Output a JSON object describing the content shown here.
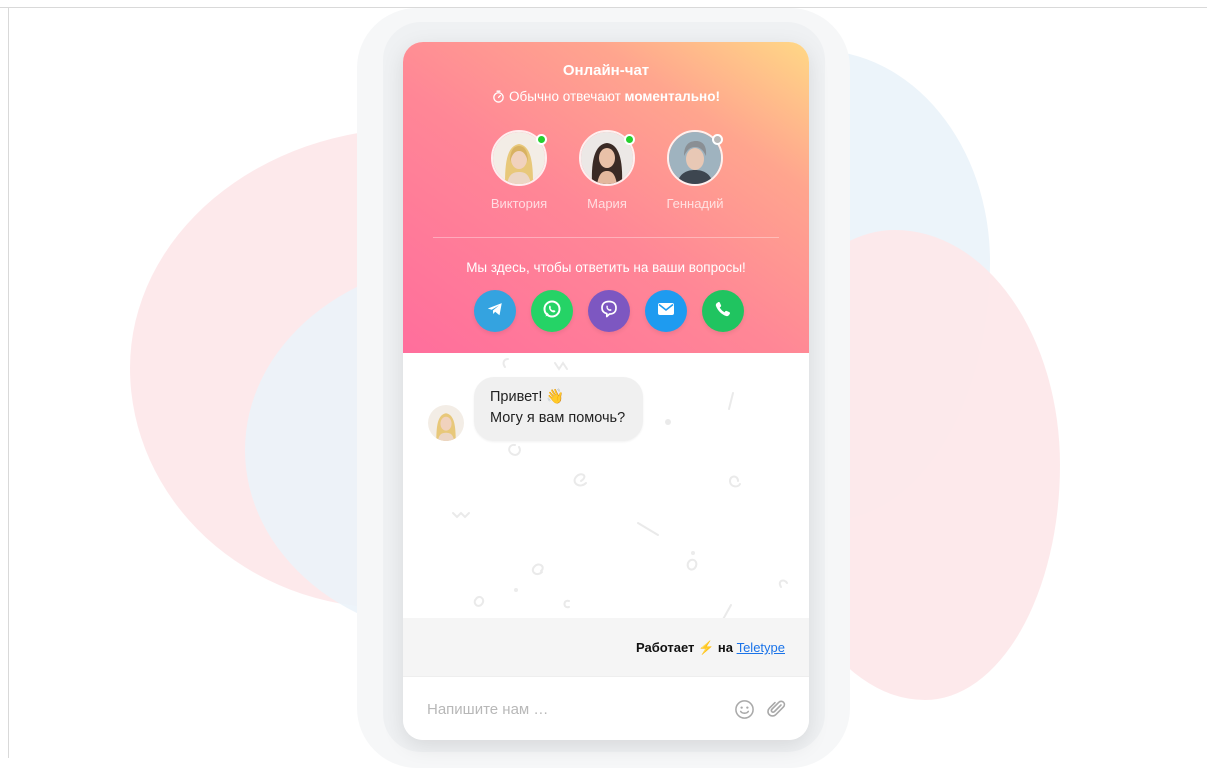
{
  "widget": {
    "title": "Онлайн-чат",
    "subtitle_prefix": "Обычно отвечают",
    "subtitle_strong": "моментально!",
    "tagline": "Мы здесь, чтобы ответить на ваши вопросы!"
  },
  "operators": [
    {
      "name": "Виктория",
      "status": "online",
      "status_color": "#25d02e"
    },
    {
      "name": "Мария",
      "status": "online",
      "status_color": "#25d02e"
    },
    {
      "name": "Геннадий",
      "status": "offline",
      "status_color": "#b9b9b9"
    }
  ],
  "channels": [
    {
      "name": "telegram",
      "icon": "telegram-icon",
      "color": "#34a3e0"
    },
    {
      "name": "whatsapp",
      "icon": "whatsapp-icon",
      "color": "#25d366"
    },
    {
      "name": "viber",
      "icon": "viber-icon",
      "color": "#7d57c1"
    },
    {
      "name": "email",
      "icon": "mail-icon",
      "color": "#1e9bf0"
    },
    {
      "name": "phone",
      "icon": "phone-icon",
      "color": "#20c460"
    }
  ],
  "message": {
    "line1": "Привет! 👋",
    "line2": "Могу я вам помочь?"
  },
  "footer": {
    "powered_prefix": "Работает",
    "bolt": "⚡",
    "powered_mid": "на",
    "brand": "Teletype"
  },
  "input": {
    "placeholder": "Напишите нам …",
    "value": ""
  }
}
